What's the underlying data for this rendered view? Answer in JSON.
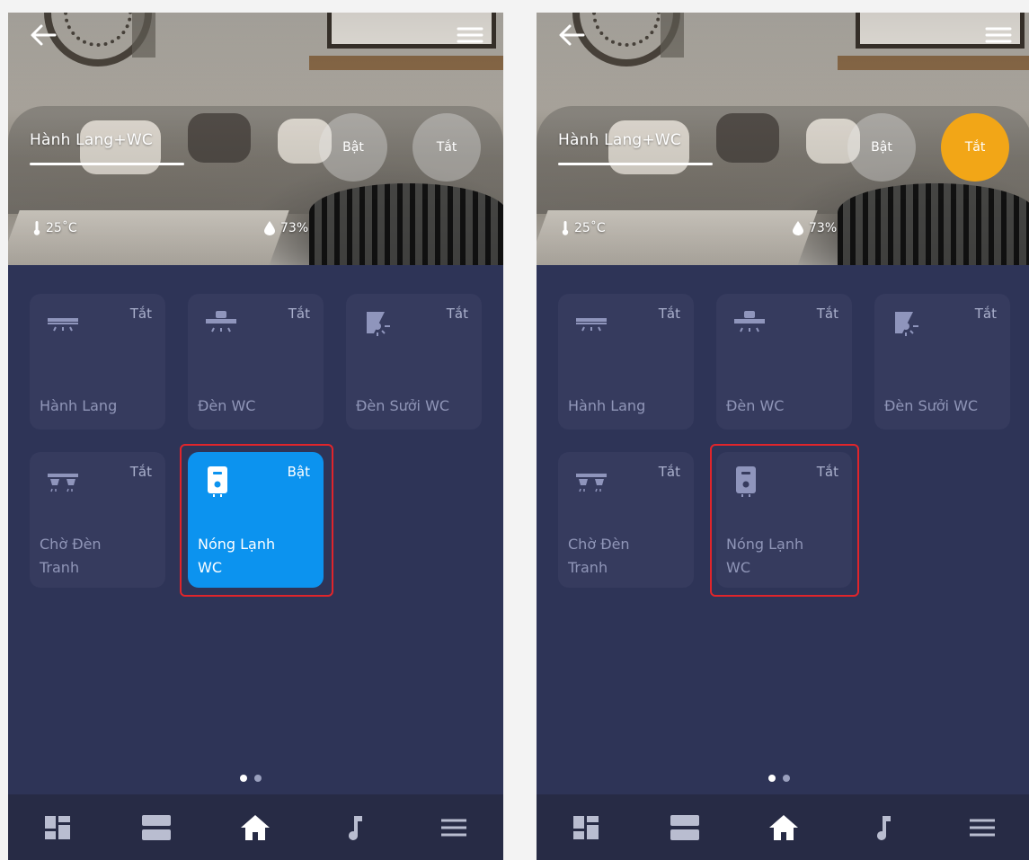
{
  "screens": [
    {
      "room": {
        "title": "Hành Lang+WC"
      },
      "scenes": {
        "on_label": "Bật",
        "off_label": "Tắt",
        "active": "none"
      },
      "climate": {
        "temperature": "25˚C",
        "humidity": "73%"
      },
      "devices": [
        {
          "name": "Hành Lang",
          "state": "Tắt",
          "icon": "ceiling-light-icon"
        },
        {
          "name": "Đèn WC",
          "state": "Tắt",
          "icon": "pendant-lamp-icon"
        },
        {
          "name": "Đèn Sưởi WC",
          "state": "Tắt",
          "icon": "heater-lamp-icon"
        },
        {
          "name_line1": "Chờ Đèn",
          "name_line2": "Tranh",
          "state": "Tắt",
          "icon": "picture-light-icon"
        },
        {
          "name_line1": "Nóng Lạnh",
          "name_line2": "WC",
          "state": "Bật",
          "icon": "water-heater-icon",
          "active": true,
          "highlighted": true
        }
      ],
      "pager": {
        "pages": 2,
        "current": 1
      },
      "nav": [
        "dashboard-icon",
        "rooms-icon",
        "home-icon",
        "music-icon",
        "menu-icon"
      ],
      "nav_active": "home-icon"
    },
    {
      "room": {
        "title": "Hành Lang+WC"
      },
      "scenes": {
        "on_label": "Bật",
        "off_label": "Tắt",
        "active": "off"
      },
      "climate": {
        "temperature": "25˚C",
        "humidity": "73%"
      },
      "devices": [
        {
          "name": "Hành Lang",
          "state": "Tắt",
          "icon": "ceiling-light-icon"
        },
        {
          "name": "Đèn WC",
          "state": "Tắt",
          "icon": "pendant-lamp-icon"
        },
        {
          "name": "Đèn Sưởi WC",
          "state": "Tắt",
          "icon": "heater-lamp-icon"
        },
        {
          "name_line1": "Chờ Đèn",
          "name_line2": "Tranh",
          "state": "Tắt",
          "icon": "picture-light-icon"
        },
        {
          "name_line1": "Nóng Lạnh",
          "name_line2": "WC",
          "state": "Tắt",
          "icon": "water-heater-icon",
          "active": false,
          "highlighted": true
        }
      ],
      "pager": {
        "pages": 2,
        "current": 1
      },
      "nav": [
        "dashboard-icon",
        "rooms-icon",
        "home-icon",
        "music-icon",
        "menu-icon"
      ],
      "nav_active": "home-icon"
    }
  ],
  "colors": {
    "background": "#2e3457",
    "tile": "#363b5e",
    "tile_active": "#0c93ef",
    "scene_active": "#f2a617",
    "highlight": "#e0252b",
    "navbar": "#272b45"
  }
}
